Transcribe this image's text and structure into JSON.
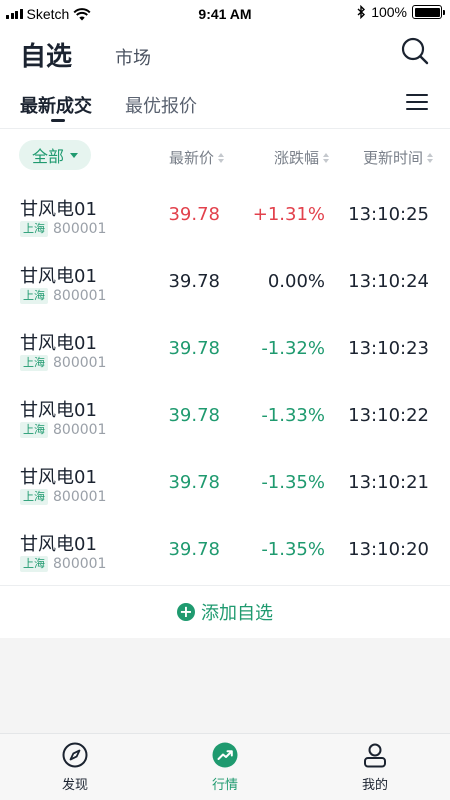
{
  "status_bar": {
    "carrier": "Sketch",
    "time": "9:41 AM",
    "battery": "100%"
  },
  "header": {
    "title": "自选",
    "market_tab": "市场"
  },
  "subtabs": {
    "active": "最新成交",
    "inactive": "最优报价"
  },
  "filter": {
    "label": "全部"
  },
  "columns": {
    "price": "最新价",
    "change": "涨跌幅",
    "time": "更新时间"
  },
  "rows": [
    {
      "name": "甘风电01",
      "exchange": "上海",
      "code": "800001",
      "price": "39.78",
      "change": "+1.31%",
      "time": "13:10:25",
      "trend": "up"
    },
    {
      "name": "甘风电01",
      "exchange": "上海",
      "code": "800001",
      "price": "39.78",
      "change": "0.00%",
      "time": "13:10:24",
      "trend": "flat"
    },
    {
      "name": "甘风电01",
      "exchange": "上海",
      "code": "800001",
      "price": "39.78",
      "change": "-1.32%",
      "time": "13:10:23",
      "trend": "down"
    },
    {
      "name": "甘风电01",
      "exchange": "上海",
      "code": "800001",
      "price": "39.78",
      "change": "-1.33%",
      "time": "13:10:22",
      "trend": "down"
    },
    {
      "name": "甘风电01",
      "exchange": "上海",
      "code": "800001",
      "price": "39.78",
      "change": "-1.35%",
      "time": "13:10:21",
      "trend": "down"
    },
    {
      "name": "甘风电01",
      "exchange": "上海",
      "code": "800001",
      "price": "39.78",
      "change": "-1.35%",
      "time": "13:10:20",
      "trend": "down"
    }
  ],
  "add_button": {
    "label": "添加自选"
  },
  "bottom_nav": [
    {
      "label": "发现",
      "icon": "compass-icon"
    },
    {
      "label": "行情",
      "icon": "trend-up-icon",
      "active": true
    },
    {
      "label": "我的",
      "icon": "user-icon"
    }
  ],
  "colors": {
    "accent": "#1f9a6f",
    "up": "#e2414c",
    "down": "#1f9a6f",
    "text": "#1b2330"
  }
}
